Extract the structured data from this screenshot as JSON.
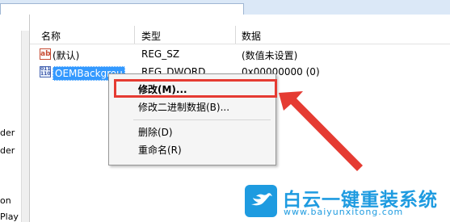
{
  "tree": {
    "items": [
      {
        "label": "der"
      },
      {
        "label": "der"
      },
      {
        "label": "on"
      },
      {
        "label": "Play"
      }
    ]
  },
  "columns": {
    "name": "名称",
    "type": "类型",
    "data": "数据"
  },
  "rows": [
    {
      "name": "(默认)",
      "type": "REG_SZ",
      "data": "(数值未设置)"
    },
    {
      "name": "OEMBackgrou",
      "type": "REG_DWORD",
      "data": "0x00000000 (0)"
    }
  ],
  "context_menu": {
    "modify": "修改(M)...",
    "modify_binary": "修改二进制数据(B)...",
    "delete": "删除(D)",
    "rename": "重命名(R)"
  },
  "colors": {
    "highlight": "#e53b32",
    "selection": "#3399ff",
    "brand": "#1e9be0"
  },
  "logo": {
    "name": "白云一键重装系统",
    "url": "www.baiyunxitong.com"
  }
}
